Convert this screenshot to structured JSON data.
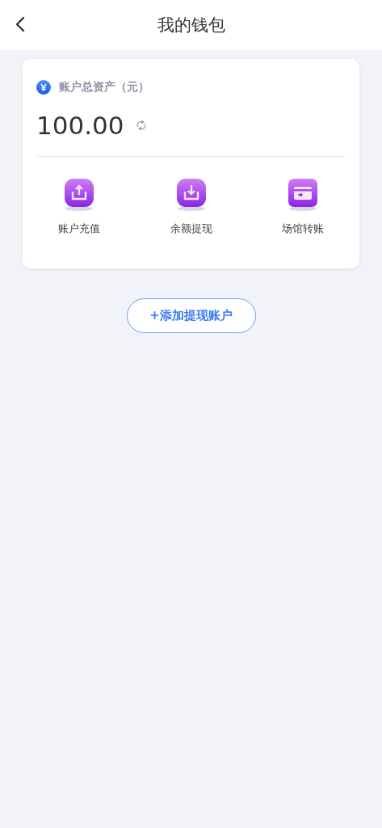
{
  "header": {
    "title": "我的钱包"
  },
  "assets": {
    "label": "账户总资产（元）",
    "amount": "100.00"
  },
  "actions": [
    {
      "kind": "upload",
      "label": "账户充值"
    },
    {
      "kind": "download",
      "label": "余额提现"
    },
    {
      "kind": "card",
      "label": "场馆转账"
    }
  ],
  "add_button": "+添加提现账户"
}
